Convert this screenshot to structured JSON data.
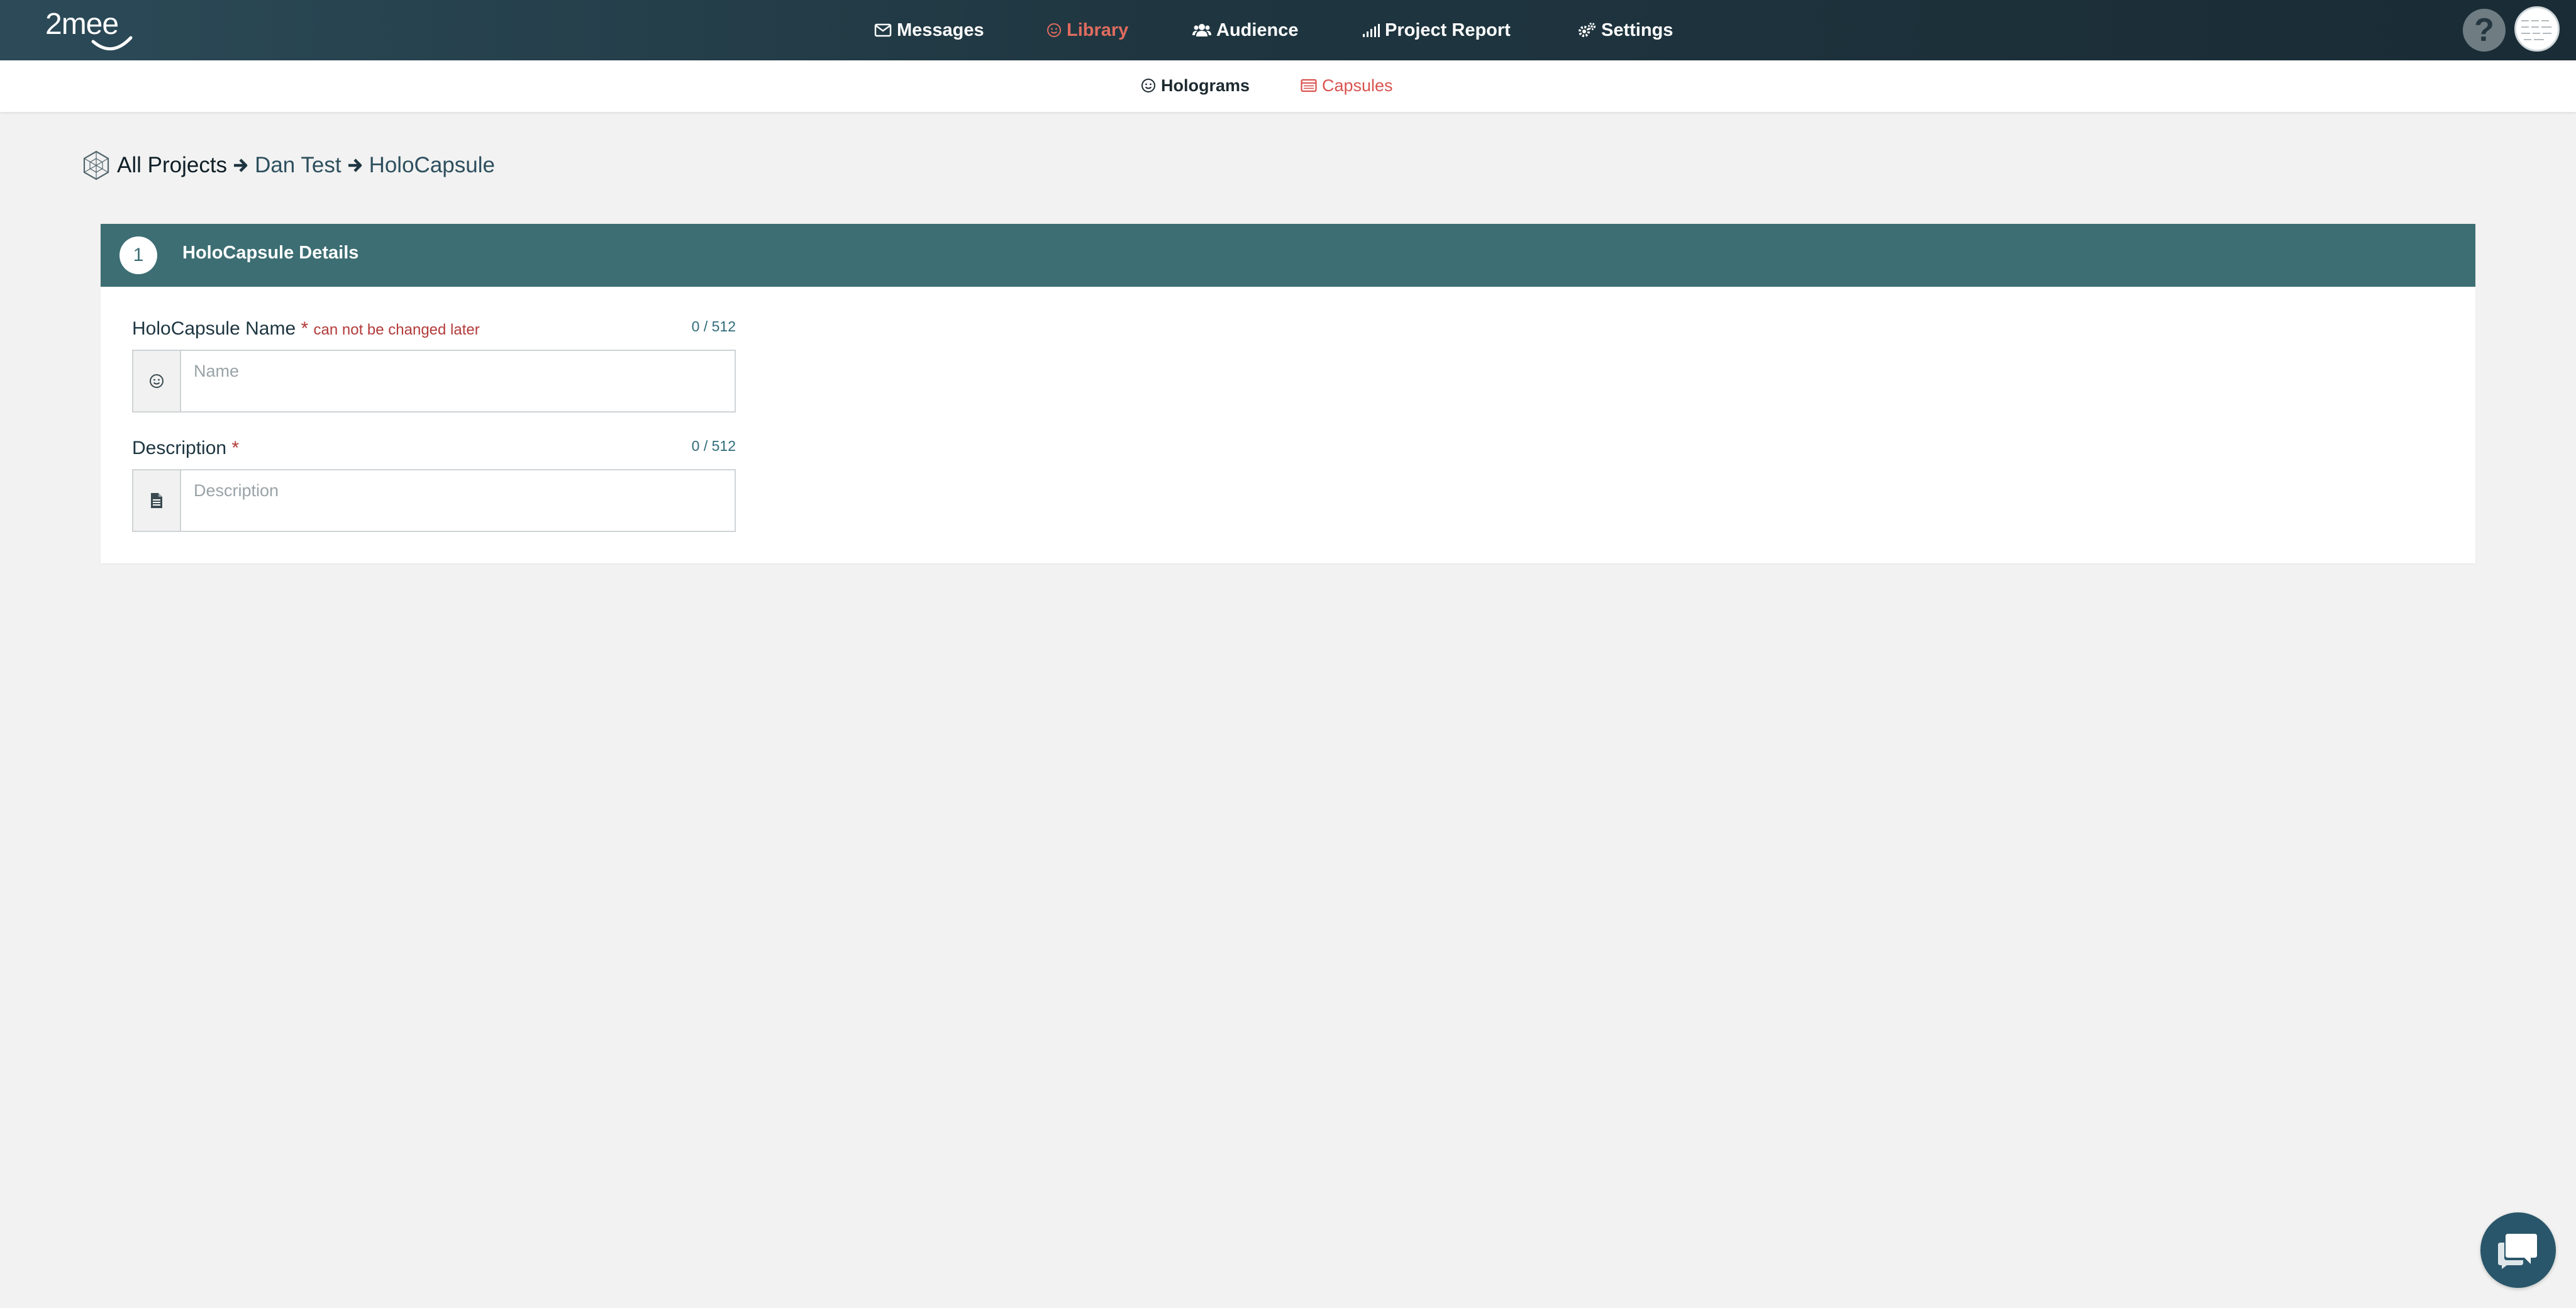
{
  "brand": {
    "logo_text": "2mee"
  },
  "top_nav": {
    "items": [
      {
        "label": "Messages",
        "icon": "envelope-icon"
      },
      {
        "label": "Library",
        "icon": "smiley-icon",
        "active": true
      },
      {
        "label": "Audience",
        "icon": "users-icon"
      },
      {
        "label": "Project Report",
        "icon": "signal-bars-icon"
      },
      {
        "label": "Settings",
        "icon": "gears-icon"
      }
    ],
    "help_label": "?"
  },
  "sub_nav": {
    "items": [
      {
        "label": "Holograms",
        "icon": "smiley-icon"
      },
      {
        "label": "Capsules",
        "icon": "capsule-icon",
        "active": true
      }
    ]
  },
  "breadcrumb": {
    "items": [
      "All Projects",
      "Dan Test",
      "HoloCapsule"
    ]
  },
  "form": {
    "step_number": "1",
    "title": "HoloCapsule Details",
    "fields": [
      {
        "label": "HoloCapsule Name",
        "required_mark": "*",
        "note": "can not be changed later",
        "counter": "0 / 512",
        "placeholder": "Name",
        "value": "",
        "icon": "smiley-icon"
      },
      {
        "label": "Description",
        "required_mark": "*",
        "note": "",
        "counter": "0 / 512",
        "placeholder": "Description",
        "value": "",
        "icon": "file-text-icon"
      }
    ]
  },
  "colors": {
    "nav_bg": "#1f3640",
    "accent_active": "#e06c5f",
    "card_header": "#3c6e73",
    "required": "#b33a3a",
    "counter": "#2f6b7a",
    "page_bg": "#f2f2f2"
  }
}
